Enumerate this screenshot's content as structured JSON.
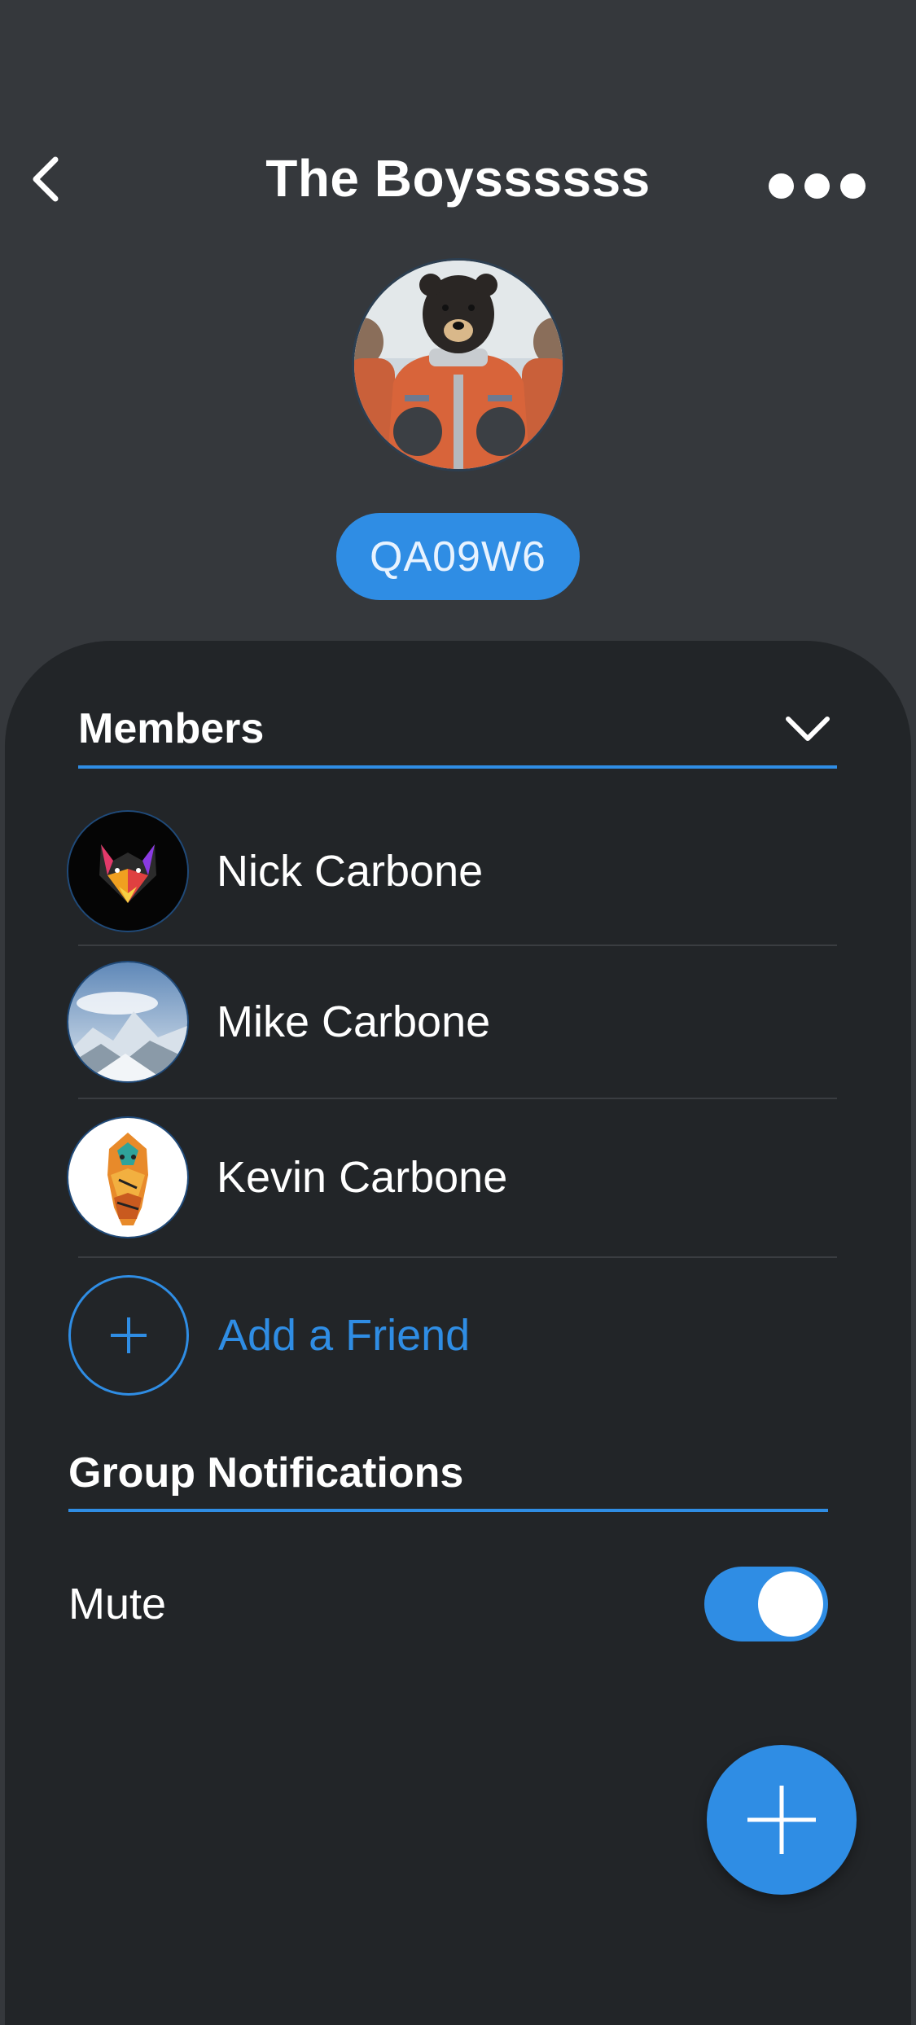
{
  "header": {
    "title": "The Boyssssss",
    "back_icon": "chevron-left-icon",
    "more_icon": "more-horizontal-icon"
  },
  "group": {
    "code": "QA09W6"
  },
  "members_section": {
    "title": "Members",
    "toggle_icon": "chevron-down-icon",
    "members": [
      {
        "name": "Nick Carbone"
      },
      {
        "name": "Mike Carbone"
      },
      {
        "name": "Kevin Carbone"
      }
    ],
    "add_friend_label": "Add a Friend"
  },
  "notifications_section": {
    "title": "Group Notifications",
    "mute_label": "Mute",
    "mute_enabled": true
  },
  "fab": {
    "icon": "plus-icon"
  },
  "colors": {
    "accent": "#2f8de4",
    "background": "#35383c",
    "sheet": "#222528"
  }
}
